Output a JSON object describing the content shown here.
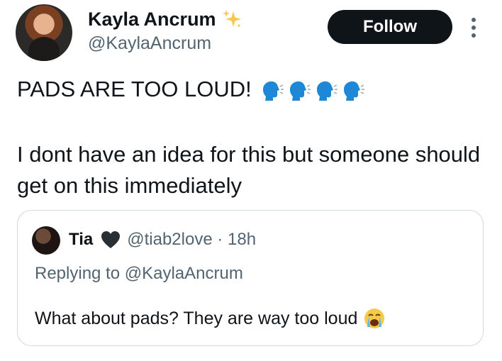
{
  "author": {
    "display_name": "Kayla Ancrum",
    "handle": "@KaylaAncrum",
    "badge_icon": "sparkles-icon"
  },
  "follow_button": {
    "label": "Follow"
  },
  "tweet": {
    "line1": "PADS ARE TOO LOUD!",
    "line1_emoji": [
      "speaking-head-icon",
      "speaking-head-icon",
      "speaking-head-icon",
      "speaking-head-icon"
    ],
    "line2": "I dont have an idea for this but someone should get on this immediately"
  },
  "quoted_tweet": {
    "name": "Tia",
    "name_emoji": "black-heart-icon",
    "handle_time": "@tiab2love · 18h",
    "replying_to": "Replying to @KaylaAncrum",
    "text": "What about pads? They are way too loud",
    "text_emoji": "loudly-crying-face-icon"
  },
  "colors": {
    "text_primary": "#0f1419",
    "text_secondary": "#536471",
    "follow_bg": "#0f1419",
    "border": "#cfd9de",
    "emoji_blue": "#1e88d6",
    "sparkle_yellow": "#f6c84c"
  }
}
